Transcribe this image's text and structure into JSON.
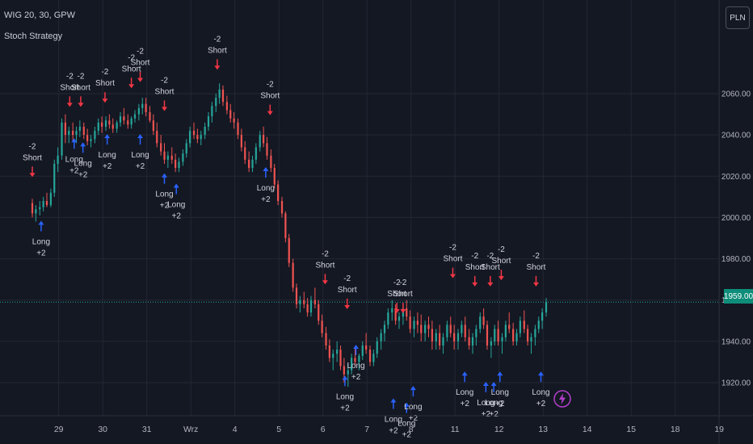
{
  "header": {
    "symbol": "WIG 20, 30, GPW",
    "strategy": "Stoch Strategy"
  },
  "currency_label": "PLN",
  "last_price_label": "1959.00",
  "colors": {
    "background": "#141823",
    "grid": "#232734",
    "axis_text": "#b2b5be",
    "up": "#26a69a",
    "down": "#ef5350",
    "long_marker": "#2962ff",
    "short_marker": "#f23645",
    "marker_text": "#d1d4dc",
    "price_line": "#26a69a",
    "bolt": "#b23ec9"
  },
  "chart_data": {
    "type": "candlestick",
    "y_ticks": [
      "2060.00",
      "2040.00",
      "2020.00",
      "2000.00",
      "1980.00",
      "1960.00",
      "1940.00",
      "1920.00"
    ],
    "y_tick_values": [
      2060,
      2040,
      2020,
      2000,
      1980,
      1960,
      1940,
      1920
    ],
    "x_ticks": [
      {
        "label": "29",
        "t": 0.6
      },
      {
        "label": "30",
        "t": 1.6
      },
      {
        "label": "31",
        "t": 2.6
      },
      {
        "label": "Wrz",
        "t": 3.6
      },
      {
        "label": "4",
        "t": 4.6
      },
      {
        "label": "5",
        "t": 5.6
      },
      {
        "label": "6",
        "t": 6.6
      },
      {
        "label": "7",
        "t": 7.6
      },
      {
        "label": "8",
        "t": 8.6
      },
      {
        "label": "11",
        "t": 9.6
      },
      {
        "label": "12",
        "t": 10.6
      },
      {
        "label": "13",
        "t": 11.6
      },
      {
        "label": "14",
        "t": 12.6
      },
      {
        "label": "15",
        "t": 13.6
      },
      {
        "label": "18",
        "t": 14.6
      },
      {
        "label": "19",
        "t": 15.6
      }
    ],
    "ylim": [
      1910,
      2080
    ],
    "tlim": [
      0,
      16.6
    ],
    "last_price": 1959,
    "candles": [
      [
        0.0,
        2007,
        2009,
        2000,
        2002
      ],
      [
        0.08,
        2002,
        2006,
        1998,
        2004
      ],
      [
        0.17,
        2004,
        2008,
        2001,
        2005
      ],
      [
        0.25,
        2005,
        2010,
        2003,
        2008
      ],
      [
        0.33,
        2008,
        2012,
        2005,
        2006
      ],
      [
        0.42,
        2006,
        2014,
        2005,
        2012
      ],
      [
        0.5,
        2012,
        2028,
        2010,
        2026
      ],
      [
        0.58,
        2026,
        2034,
        2022,
        2030
      ],
      [
        0.67,
        2030,
        2048,
        2028,
        2046
      ],
      [
        0.75,
        2046,
        2050,
        2036,
        2040
      ],
      [
        0.83,
        2040,
        2044,
        2036,
        2042
      ],
      [
        0.92,
        2042,
        2046,
        2037,
        2040
      ],
      [
        1.0,
        2040,
        2044,
        2036,
        2042
      ],
      [
        1.08,
        2042,
        2047,
        2039,
        2044
      ],
      [
        1.17,
        2044,
        2046,
        2038,
        2040
      ],
      [
        1.25,
        2040,
        2043,
        2035,
        2037
      ],
      [
        1.33,
        2037,
        2040,
        2034,
        2038
      ],
      [
        1.42,
        2038,
        2044,
        2036,
        2042
      ],
      [
        1.5,
        2042,
        2048,
        2040,
        2046
      ],
      [
        1.58,
        2046,
        2049,
        2041,
        2044
      ],
      [
        1.67,
        2044,
        2049,
        2042,
        2047
      ],
      [
        1.75,
        2047,
        2050,
        2043,
        2045
      ],
      [
        1.83,
        2045,
        2048,
        2041,
        2043
      ],
      [
        1.92,
        2043,
        2047,
        2041,
        2046
      ],
      [
        2.0,
        2046,
        2051,
        2044,
        2049
      ],
      [
        2.08,
        2049,
        2053,
        2045,
        2047
      ],
      [
        2.17,
        2047,
        2050,
        2043,
        2045
      ],
      [
        2.25,
        2045,
        2049,
        2043,
        2048
      ],
      [
        2.33,
        2048,
        2052,
        2046,
        2050
      ],
      [
        2.42,
        2050,
        2055,
        2047,
        2053
      ],
      [
        2.5,
        2053,
        2058,
        2050,
        2055
      ],
      [
        2.58,
        2055,
        2058,
        2049,
        2051
      ],
      [
        2.67,
        2051,
        2054,
        2046,
        2047
      ],
      [
        2.75,
        2047,
        2050,
        2040,
        2042
      ],
      [
        2.83,
        2042,
        2046,
        2034,
        2036
      ],
      [
        2.92,
        2036,
        2040,
        2030,
        2032
      ],
      [
        3.0,
        2032,
        2036,
        2026,
        2028
      ],
      [
        3.08,
        2028,
        2032,
        2024,
        2030
      ],
      [
        3.17,
        2030,
        2034,
        2026,
        2028
      ],
      [
        3.25,
        2028,
        2031,
        2022,
        2024
      ],
      [
        3.33,
        2024,
        2029,
        2022,
        2027
      ],
      [
        3.42,
        2027,
        2033,
        2025,
        2031
      ],
      [
        3.5,
        2031,
        2038,
        2029,
        2036
      ],
      [
        3.58,
        2036,
        2044,
        2034,
        2042
      ],
      [
        3.67,
        2042,
        2046,
        2038,
        2040
      ],
      [
        3.75,
        2040,
        2043,
        2036,
        2038
      ],
      [
        3.83,
        2038,
        2042,
        2035,
        2040
      ],
      [
        3.92,
        2040,
        2046,
        2038,
        2044
      ],
      [
        4.0,
        2044,
        2051,
        2042,
        2049
      ],
      [
        4.08,
        2049,
        2056,
        2046,
        2054
      ],
      [
        4.17,
        2054,
        2060,
        2051,
        2058
      ],
      [
        4.25,
        2058,
        2065,
        2055,
        2062
      ],
      [
        4.33,
        2062,
        2064,
        2054,
        2056
      ],
      [
        4.42,
        2056,
        2059,
        2050,
        2052
      ],
      [
        4.5,
        2052,
        2055,
        2046,
        2048
      ],
      [
        4.58,
        2048,
        2051,
        2043,
        2046
      ],
      [
        4.67,
        2046,
        2048,
        2038,
        2040
      ],
      [
        4.75,
        2040,
        2043,
        2032,
        2034
      ],
      [
        4.83,
        2034,
        2037,
        2026,
        2028
      ],
      [
        4.92,
        2028,
        2032,
        2022,
        2024
      ],
      [
        5.0,
        2024,
        2030,
        2022,
        2028
      ],
      [
        5.08,
        2028,
        2036,
        2026,
        2034
      ],
      [
        5.17,
        2034,
        2042,
        2032,
        2040
      ],
      [
        5.25,
        2040,
        2044,
        2034,
        2036
      ],
      [
        5.33,
        2036,
        2039,
        2028,
        2030
      ],
      [
        5.42,
        2030,
        2033,
        2022,
        2024
      ],
      [
        5.5,
        2024,
        2026,
        2014,
        2016
      ],
      [
        5.58,
        2016,
        2018,
        2006,
        2008
      ],
      [
        5.67,
        2008,
        2010,
        2000,
        2002
      ],
      [
        5.75,
        2002,
        2003,
        1988,
        1990
      ],
      [
        5.83,
        1990,
        1992,
        1976,
        1978
      ],
      [
        5.92,
        1978,
        1980,
        1964,
        1966
      ],
      [
        6.0,
        1966,
        1968,
        1956,
        1958
      ],
      [
        6.08,
        1958,
        1962,
        1954,
        1960
      ],
      [
        6.17,
        1960,
        1964,
        1956,
        1958
      ],
      [
        6.25,
        1958,
        1961,
        1952,
        1954
      ],
      [
        6.33,
        1954,
        1962,
        1952,
        1960
      ],
      [
        6.42,
        1960,
        1966,
        1956,
        1958
      ],
      [
        6.5,
        1958,
        1960,
        1948,
        1950
      ],
      [
        6.58,
        1950,
        1953,
        1942,
        1944
      ],
      [
        6.67,
        1944,
        1947,
        1936,
        1938
      ],
      [
        6.75,
        1938,
        1941,
        1930,
        1932
      ],
      [
        6.83,
        1932,
        1936,
        1926,
        1934
      ],
      [
        6.92,
        1934,
        1940,
        1930,
        1936
      ],
      [
        7.0,
        1936,
        1938,
        1926,
        1928
      ],
      [
        7.08,
        1928,
        1932,
        1920,
        1924
      ],
      [
        7.17,
        1924,
        1929,
        1918,
        1926
      ],
      [
        7.25,
        1926,
        1934,
        1924,
        1932
      ],
      [
        7.33,
        1932,
        1937,
        1928,
        1930
      ],
      [
        7.42,
        1930,
        1934,
        1926,
        1933
      ],
      [
        7.5,
        1933,
        1940,
        1931,
        1938
      ],
      [
        7.58,
        1938,
        1944,
        1934,
        1936
      ],
      [
        7.67,
        1936,
        1938,
        1928,
        1930
      ],
      [
        7.75,
        1930,
        1936,
        1928,
        1934
      ],
      [
        7.83,
        1934,
        1942,
        1932,
        1940
      ],
      [
        7.92,
        1940,
        1946,
        1936,
        1944
      ],
      [
        8.0,
        1944,
        1950,
        1940,
        1948
      ],
      [
        8.08,
        1948,
        1956,
        1946,
        1954
      ],
      [
        8.17,
        1954,
        1960,
        1950,
        1956
      ],
      [
        8.25,
        1956,
        1958,
        1948,
        1950
      ],
      [
        8.33,
        1950,
        1954,
        1946,
        1952
      ],
      [
        8.42,
        1952,
        1958,
        1948,
        1956
      ],
      [
        8.5,
        1956,
        1960,
        1950,
        1952
      ],
      [
        8.58,
        1952,
        1955,
        1944,
        1946
      ],
      [
        8.67,
        1946,
        1952,
        1942,
        1950
      ],
      [
        8.75,
        1950,
        1954,
        1944,
        1948
      ],
      [
        8.83,
        1948,
        1953,
        1940,
        1944
      ],
      [
        8.92,
        1944,
        1950,
        1940,
        1948
      ],
      [
        9.0,
        1948,
        1952,
        1942,
        1946
      ],
      [
        9.08,
        1946,
        1950,
        1936,
        1940
      ],
      [
        9.17,
        1940,
        1946,
        1936,
        1944
      ],
      [
        9.25,
        1944,
        1948,
        1936,
        1938
      ],
      [
        9.33,
        1938,
        1944,
        1934,
        1942
      ],
      [
        9.42,
        1942,
        1950,
        1940,
        1948
      ],
      [
        9.5,
        1948,
        1952,
        1942,
        1944
      ],
      [
        9.58,
        1944,
        1948,
        1936,
        1940
      ],
      [
        9.67,
        1940,
        1946,
        1936,
        1944
      ],
      [
        9.75,
        1944,
        1950,
        1942,
        1948
      ],
      [
        9.83,
        1948,
        1952,
        1940,
        1942
      ],
      [
        9.92,
        1942,
        1946,
        1936,
        1938
      ],
      [
        10.0,
        1938,
        1944,
        1934,
        1942
      ],
      [
        10.08,
        1942,
        1948,
        1938,
        1946
      ],
      [
        10.17,
        1946,
        1954,
        1944,
        1952
      ],
      [
        10.25,
        1952,
        1956,
        1946,
        1948
      ],
      [
        10.33,
        1948,
        1950,
        1936,
        1938
      ],
      [
        10.42,
        1938,
        1942,
        1932,
        1940
      ],
      [
        10.5,
        1940,
        1948,
        1938,
        1946
      ],
      [
        10.58,
        1946,
        1950,
        1938,
        1940
      ],
      [
        10.67,
        1940,
        1944,
        1934,
        1942
      ],
      [
        10.75,
        1942,
        1950,
        1940,
        1948
      ],
      [
        10.83,
        1948,
        1954,
        1944,
        1946
      ],
      [
        10.92,
        1946,
        1949,
        1938,
        1940
      ],
      [
        11.0,
        1940,
        1946,
        1938,
        1944
      ],
      [
        11.08,
        1944,
        1952,
        1942,
        1950
      ],
      [
        11.17,
        1950,
        1955,
        1944,
        1946
      ],
      [
        11.25,
        1946,
        1948,
        1938,
        1940
      ],
      [
        11.33,
        1940,
        1944,
        1934,
        1942
      ],
      [
        11.42,
        1942,
        1948,
        1938,
        1946
      ],
      [
        11.5,
        1946,
        1952,
        1944,
        1950
      ],
      [
        11.58,
        1950,
        1956,
        1946,
        1954
      ],
      [
        11.67,
        1954,
        1961,
        1952,
        1959
      ]
    ],
    "markers": [
      {
        "type": "short",
        "t": 0.0,
        "price": 2020,
        "label_top": "-2",
        "label_bottom": "Short"
      },
      {
        "type": "long",
        "t": 0.2,
        "price": 1998,
        "label_top": "Long",
        "label_bottom": "+2"
      },
      {
        "type": "short",
        "t": 0.85,
        "price": 2054,
        "label_top": "-2",
        "label_bottom": "Short"
      },
      {
        "type": "short",
        "t": 1.1,
        "price": 2054,
        "label_top": "-2",
        "label_bottom": "Short"
      },
      {
        "type": "long",
        "t": 0.95,
        "price": 2038,
        "label_top": "Long",
        "label_bottom": "+2"
      },
      {
        "type": "long",
        "t": 1.15,
        "price": 2036,
        "label_top": "Long",
        "label_bottom": "+2"
      },
      {
        "type": "short",
        "t": 1.65,
        "price": 2056,
        "label_top": "-2",
        "label_bottom": "Short"
      },
      {
        "type": "long",
        "t": 1.7,
        "price": 2040,
        "label_top": "Long",
        "label_bottom": "+2"
      },
      {
        "type": "short",
        "t": 2.25,
        "price": 2063,
        "label_top": "-2",
        "label_bottom": "Short"
      },
      {
        "type": "short",
        "t": 2.45,
        "price": 2066,
        "label_top": "-2",
        "label_bottom": "Short"
      },
      {
        "type": "long",
        "t": 2.45,
        "price": 2040,
        "label_top": "Long",
        "label_bottom": "+2"
      },
      {
        "type": "short",
        "t": 3.0,
        "price": 2052,
        "label_top": "-2",
        "label_bottom": "Short"
      },
      {
        "type": "long",
        "t": 3.0,
        "price": 2021,
        "label_top": "Long",
        "label_bottom": "+2"
      },
      {
        "type": "long",
        "t": 3.27,
        "price": 2016,
        "label_top": "Long",
        "label_bottom": "+2"
      },
      {
        "type": "short",
        "t": 4.2,
        "price": 2072,
        "label_top": "-2",
        "label_bottom": "Short"
      },
      {
        "type": "short",
        "t": 5.4,
        "price": 2050,
        "label_top": "-2",
        "label_bottom": "Short"
      },
      {
        "type": "long",
        "t": 5.3,
        "price": 2024,
        "label_top": "Long",
        "label_bottom": "+2"
      },
      {
        "type": "short",
        "t": 6.65,
        "price": 1968,
        "label_top": "-2",
        "label_bottom": "Short"
      },
      {
        "type": "short",
        "t": 7.15,
        "price": 1956,
        "label_top": "-2",
        "label_bottom": "Short"
      },
      {
        "type": "long",
        "t": 7.35,
        "price": 1938,
        "label_top": "Long",
        "label_bottom": "+2"
      },
      {
        "type": "long",
        "t": 7.1,
        "price": 1923,
        "label_top": "Long",
        "label_bottom": "+2"
      },
      {
        "type": "short",
        "t": 8.28,
        "price": 1954,
        "label_top": "-2",
        "label_bottom": "Short"
      },
      {
        "type": "short",
        "t": 8.42,
        "price": 1954,
        "label_top": "-2",
        "label_bottom": "Short"
      },
      {
        "type": "long",
        "t": 8.2,
        "price": 1912,
        "label_top": "Long",
        "label_bottom": "+2"
      },
      {
        "type": "long",
        "t": 8.5,
        "price": 1910,
        "label_top": "Long",
        "label_bottom": "+2"
      },
      {
        "type": "long",
        "t": 8.65,
        "price": 1918,
        "label_top": "Long",
        "label_bottom": "+2"
      },
      {
        "type": "short",
        "t": 9.55,
        "price": 1971,
        "label_top": "-2",
        "label_bottom": "Short"
      },
      {
        "type": "short",
        "t": 10.05,
        "price": 1967,
        "label_top": "-2",
        "label_bottom": "Short"
      },
      {
        "type": "short",
        "t": 10.4,
        "price": 1967,
        "label_top": "-2",
        "label_bottom": "Short"
      },
      {
        "type": "short",
        "t": 10.65,
        "price": 1970,
        "label_top": "-2",
        "label_bottom": "Short"
      },
      {
        "type": "long",
        "t": 9.82,
        "price": 1925,
        "label_top": "Long",
        "label_bottom": "+2"
      },
      {
        "type": "long",
        "t": 10.3,
        "price": 1920,
        "label_top": "Long",
        "label_bottom": "+2"
      },
      {
        "type": "long",
        "t": 10.48,
        "price": 1920,
        "label_top": "Long",
        "label_bottom": "+2"
      },
      {
        "type": "long",
        "t": 10.62,
        "price": 1925,
        "label_top": "Long",
        "label_bottom": "+2"
      },
      {
        "type": "short",
        "t": 11.44,
        "price": 1967,
        "label_top": "-2",
        "label_bottom": "Short"
      },
      {
        "type": "long",
        "t": 11.55,
        "price": 1925,
        "label_top": "Long",
        "label_bottom": "+2"
      }
    ]
  }
}
